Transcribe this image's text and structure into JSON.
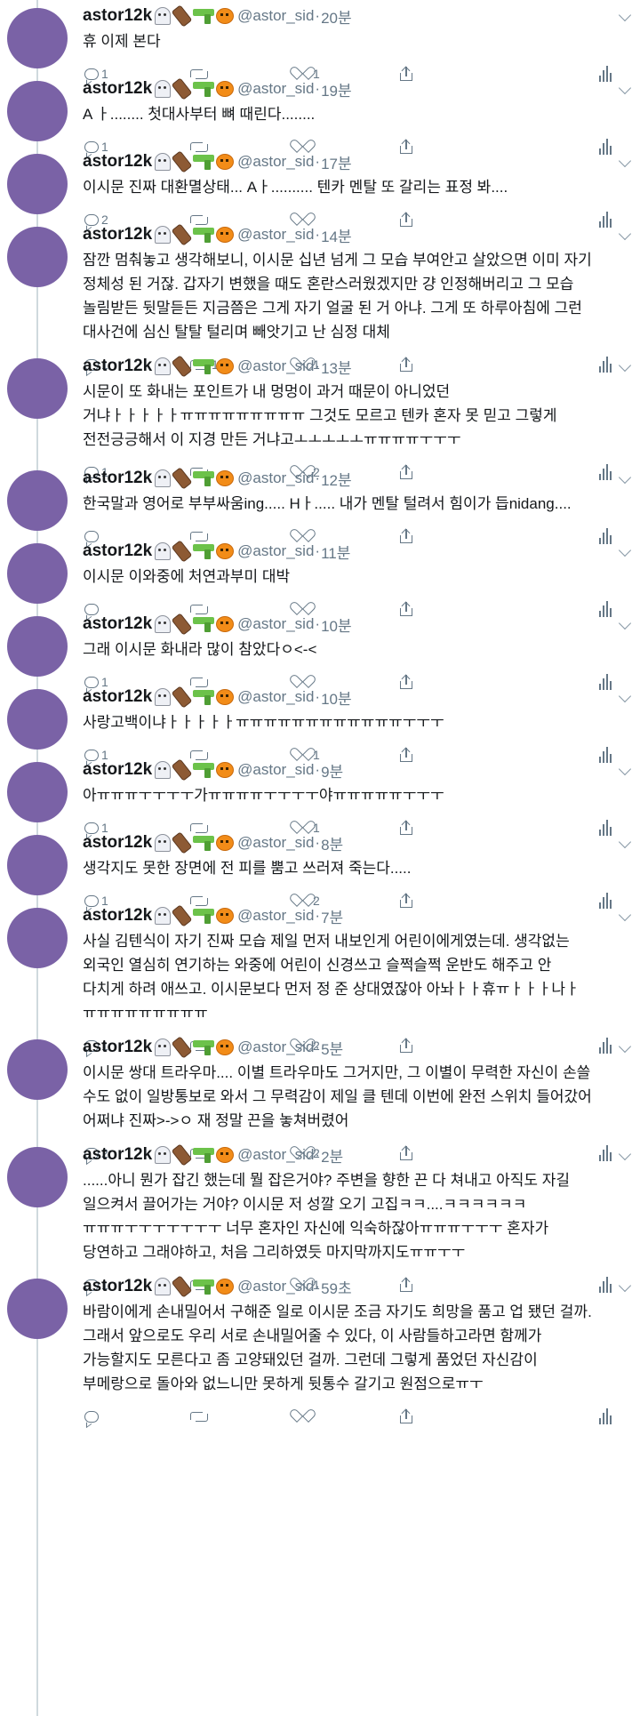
{
  "user": {
    "name": "astor12k",
    "handle": "@astor_sid",
    "emoji_icons": [
      "ghost-icon",
      "coffin-icon",
      "water-pistol-icon",
      "pumpkin-icon"
    ],
    "avatar_color": "#7a62a6"
  },
  "separator": "·",
  "colors": {
    "text": "#14171a",
    "muted": "#657786",
    "thread_line": "#cfd9de"
  },
  "tweets": [
    {
      "time": "20분",
      "text": "휴 이제 본다",
      "replies": "1",
      "retweets": "",
      "likes": "1"
    },
    {
      "time": "19분",
      "text": "A ㅏ........ 첫대사부터 뼈 때린다........",
      "replies": "1",
      "retweets": "",
      "likes": ""
    },
    {
      "time": "17분",
      "text": "이시문 진짜 대환멸상태... Aㅏ.......... 텐카 멘탈 또 갈리는 표정 봐....",
      "replies": "2",
      "retweets": "",
      "likes": ""
    },
    {
      "time": "14분",
      "text": "잠깐 멈춰놓고 생각해보니, 이시문 십년 넘게 그 모습 부여안고 살았으면 이미 자기\n정체성 된 거잖. 갑자기 변했을 때도 혼란스러웠겠지만 걍 인정해버리고 그 모습\n놀림받든 뒷말듣든 지금쯤은 그게 자기 얼굴 된 거 아냐. 그게 또 하루아침에 그런\n대사건에 심신 탈탈 털리며 빼앗기고 난 심정 대체",
      "replies": "1",
      "retweets": "1",
      "likes": "1"
    },
    {
      "time": "13분",
      "text": "시문이 또 화내는 포인트가 내 멍멍이 과거 때문이 아니었던\n거냐ㅏㅏㅏㅏㅏㅠㅠㅠㅠㅠㅠㅠㅠㅠ 그것도 모르고 텐카 혼자 못 믿고 그렇게\n전전긍긍해서 이 지경 만든 거냐고ㅗㅗㅗㅗㅗㅠㅠㅠㅠㅜㅜㅜ",
      "replies": "1",
      "retweets": "",
      "likes": "2"
    },
    {
      "time": "12분",
      "text": "한국말과 영어로 부부싸움ing..... Hㅏ..... 내가 멘탈 털려서 힘이가 듭nidang....",
      "replies": "",
      "retweets": "",
      "likes": ""
    },
    {
      "time": "11분",
      "text": "이시문 이와중에 처연과부미 대박",
      "replies": "",
      "retweets": "",
      "likes": ""
    },
    {
      "time": "10분",
      "text": "그래 이시문 화내라 많이 참았다ㅇ<-<",
      "replies": "1",
      "retweets": "",
      "likes": ""
    },
    {
      "time": "10분",
      "text": "사랑고백이냐ㅏㅏㅏㅏㅏㅠㅠㅠㅠㅠㅠㅠㅠㅠㅠㅠㅠㅜㅜㅜ",
      "replies": "1",
      "retweets": "",
      "likes": "1"
    },
    {
      "time": "9분",
      "text": "아ㅠㅠㅠㅜㅜㅜㅜ가ㅠㅠㅠㅠㅜㅜㅜㅜ야ㅠㅠㅠㅠㅠㅜㅜㅜ",
      "replies": "1",
      "retweets": "",
      "likes": "1"
    },
    {
      "time": "8분",
      "text": "생각지도 못한 장면에 전 피를 뿜고 쓰러져 죽는다.....",
      "replies": "1",
      "retweets": "",
      "likes": "2"
    },
    {
      "time": "7분",
      "text": "사실 김텐식이 자기 진짜 모습 제일 먼저 내보인게 어린이에게였는데. 생각없는\n외국인 열심히 연기하는 와중에 어린이 신경쓰고 슬쩍슬쩍 운반도 해주고 안\n다치게 하려 애쓰고. 이시문보다 먼저 정 준 상대였잖아 아놔ㅏㅏ휴ㅠㅏㅏㅏ나ㅏ\nㅠㅠㅠㅠㅠㅠㅠㅠㅠ",
      "replies": "1",
      "retweets": "",
      "likes": "2"
    },
    {
      "time": "5분",
      "text": "이시문 쌍대 트라우마.... 이별 트라우마도 그거지만, 그 이별이 무력한 자신이 손쓸\n수도 없이 일방통보로 와서 그 무력감이 제일 클 텐데 이번에 완전 스위치 들어갔어\n어쩌냐 진짜>->ㅇ 재 정말 끈을 놓쳐버렸어",
      "replies": "2",
      "retweets": "",
      "likes": "2"
    },
    {
      "time": "2분",
      "text": "......아니 뭔가 잡긴 했는데 뭘 잡은거야? 주변을 향한 끈 다 쳐내고 아직도 자길\n일으켜서 끌어가는 거야? 이시문 저 성깔 오기 고집ㅋㅋ....ㅋㅋㅋㅋㅋㅋ\nㅠㅠㅠㅜㅜㅜㅜㅜㅜㅜ 너무 혼자인 자신에 익숙하잖아ㅠㅠㅠㅜㅜㅜ 혼자가\n당연하고 그래야하고, 처음 그리하였듯 마지막까지도ㅠㅠㅜㅜ",
      "replies": "1",
      "retweets": "",
      "likes": "1"
    },
    {
      "time": "59초",
      "text": "바람이에게 손내밀어서 구해준 일로 이시문 조금 자기도 희망을 품고 업 됐던 걸까.\n그래서 앞으로도 우리 서로 손내밀어줄 수 있다, 이 사람들하고라면 함께가\n가능할지도 모른다고 좀 고양돼있던 걸까. 그런데 그렇게 품었던 자신감이\n부메랑으로 돌아와 없느니만 못하게 뒷통수 갈기고 원점으로ㅠㅜ",
      "replies": "",
      "retweets": "",
      "likes": ""
    }
  ]
}
